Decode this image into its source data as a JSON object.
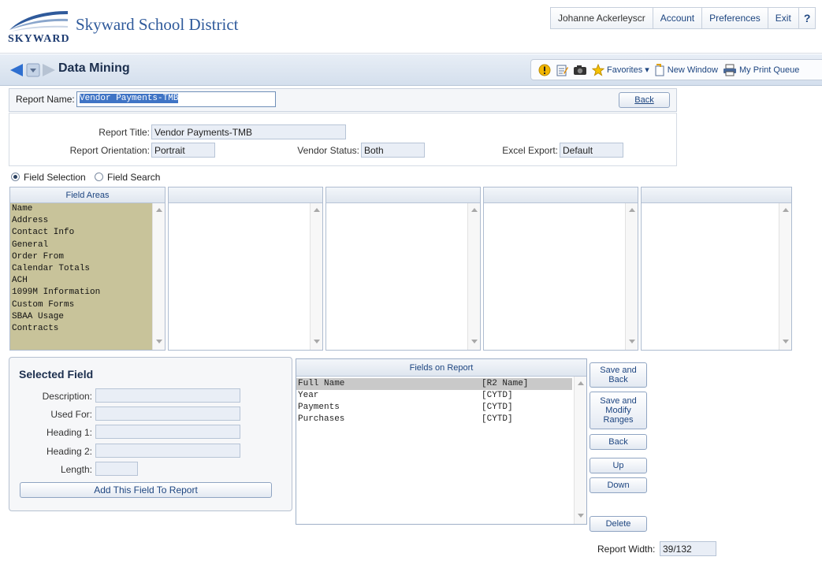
{
  "header": {
    "logo_text": "SKYWARD",
    "district": "Skyward School District",
    "user": "Johanne Ackerleyscr",
    "nav": [
      "Account",
      "Preferences",
      "Exit"
    ],
    "help": "?"
  },
  "titlebar": {
    "title": "Data Mining",
    "favorites": "Favorites",
    "new_window": "New Window",
    "print_queue": "My Print Queue"
  },
  "report": {
    "name_label": "Report Name:",
    "name_value": "Vendor Payments-TMB",
    "back_label": "Back",
    "title_label": "Report Title:",
    "title_value": "Vendor Payments-TMB",
    "orientation_label": "Report Orientation:",
    "orientation_value": "Portrait",
    "vendor_status_label": "Vendor Status:",
    "vendor_status_value": "Both",
    "excel_label": "Excel Export:",
    "excel_value": "Default"
  },
  "mode": {
    "selection": "Field Selection",
    "search": "Field Search",
    "selected": "selection"
  },
  "field_areas": {
    "header": "Field Areas",
    "items": [
      "Name",
      "Address",
      "Contact Info",
      "General",
      "Order From",
      "Calendar Totals",
      "ACH",
      "1099M Information",
      "Custom Forms",
      "SBAA Usage",
      "Contracts"
    ]
  },
  "selected_field": {
    "title": "Selected Field",
    "description_label": "Description:",
    "used_for_label": "Used For:",
    "heading1_label": "Heading 1:",
    "heading2_label": "Heading 2:",
    "length_label": "Length:",
    "add_button": "Add This Field To Report"
  },
  "fields_on_report": {
    "header": "Fields on Report",
    "rows": [
      {
        "name": "Full Name",
        "code": "[R2 Name]"
      },
      {
        "name": "Year",
        "code": "[CYTD]"
      },
      {
        "name": "Payments",
        "code": "[CYTD]"
      },
      {
        "name": "Purchases",
        "code": "[CYTD]"
      }
    ]
  },
  "actions": {
    "save_back": "Save and Back",
    "save_modify": "Save and Modify Ranges",
    "back": "Back",
    "up": "Up",
    "down": "Down",
    "delete": "Delete"
  },
  "report_width": {
    "label": "Report Width:",
    "value": "39/132"
  },
  "colors": {
    "accent": "#2f5a9b",
    "field_area_bg": "#c8c39a",
    "selection": "#3f74c5"
  }
}
